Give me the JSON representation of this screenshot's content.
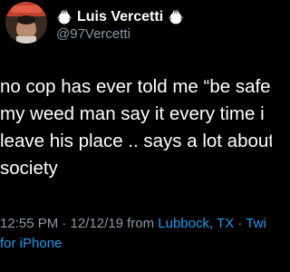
{
  "user": {
    "display_name": "Luis Vercetti",
    "handle": "@97Vercetti",
    "name_decoration_icon": "snowflake-emoji-icon"
  },
  "tweet": {
    "lines": [
      "no cop has ever told me “be safe",
      "my weed man say it every time i",
      "leave his place .. says a lot about",
      "society"
    ]
  },
  "meta": {
    "timestamp": "12:55 PM · 12/12/19 from ",
    "location": "Lubbock, TX",
    "separator": " · ",
    "source_part1": "Twi",
    "source_part2": "for iPhone"
  },
  "colors": {
    "background": "#000000",
    "text": "#ffffff",
    "secondary": "#8b98a5",
    "link": "#1d9bf0"
  }
}
